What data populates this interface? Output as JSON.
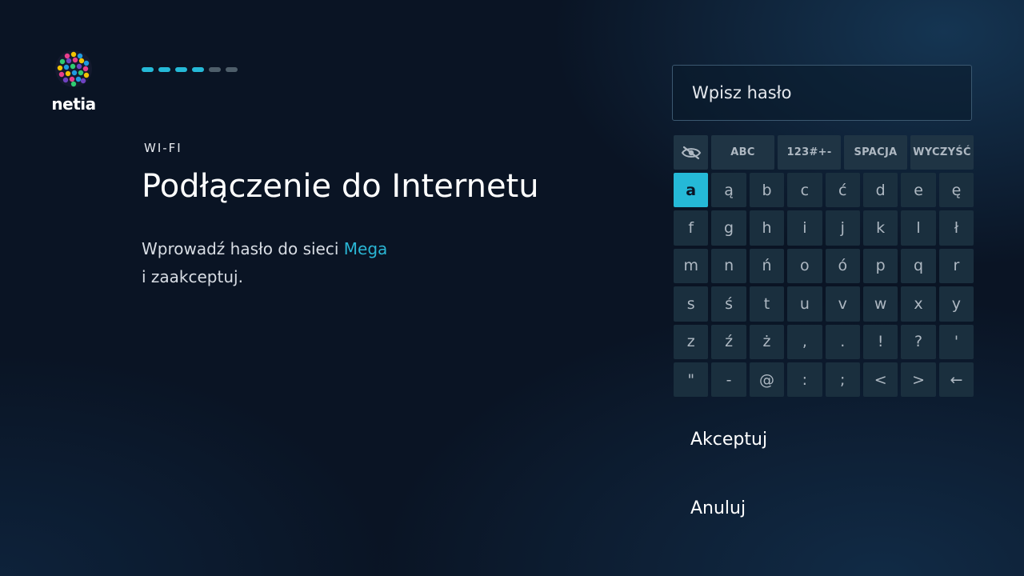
{
  "brand": {
    "name": "netia"
  },
  "progress": {
    "total": 6,
    "completed": 4,
    "color_done": "#25b9d7",
    "color_pending": "#4e5e6a"
  },
  "header": {
    "section": "WI-FI",
    "title": "Podłączenie do Internetu"
  },
  "description": {
    "before": "Wprowadź hasło do sieci ",
    "network": "Mega",
    "after": "i zaakceptuj."
  },
  "password": {
    "placeholder": "Wpisz hasło"
  },
  "keyboard": {
    "modes": [
      {
        "name": "visibility-toggle",
        "label": "",
        "icon": "eye-off-icon"
      },
      {
        "name": "mode-abc",
        "label": "ABC"
      },
      {
        "name": "mode-symbols",
        "label": "123#+-"
      },
      {
        "name": "space",
        "label": "SPACJA"
      },
      {
        "name": "clear",
        "label": "WYCZYŚĆ"
      }
    ],
    "selected_key": "a",
    "keys": [
      "a",
      "ą",
      "b",
      "c",
      "ć",
      "d",
      "e",
      "ę",
      "f",
      "g",
      "h",
      "i",
      "j",
      "k",
      "l",
      "ł",
      "m",
      "n",
      "ń",
      "o",
      "ó",
      "p",
      "q",
      "r",
      "s",
      "ś",
      "t",
      "u",
      "v",
      "w",
      "x",
      "y",
      "z",
      "ź",
      "ż",
      ",",
      ".",
      "!",
      "?",
      "'",
      "\"",
      "-",
      "@",
      ":",
      ";",
      "<",
      ">",
      "←"
    ]
  },
  "actions": {
    "accept": "Akceptuj",
    "cancel": "Anuluj"
  },
  "colors": {
    "accent": "#25b9d7",
    "background": "#0a1424",
    "key": "#1a2f3e"
  }
}
